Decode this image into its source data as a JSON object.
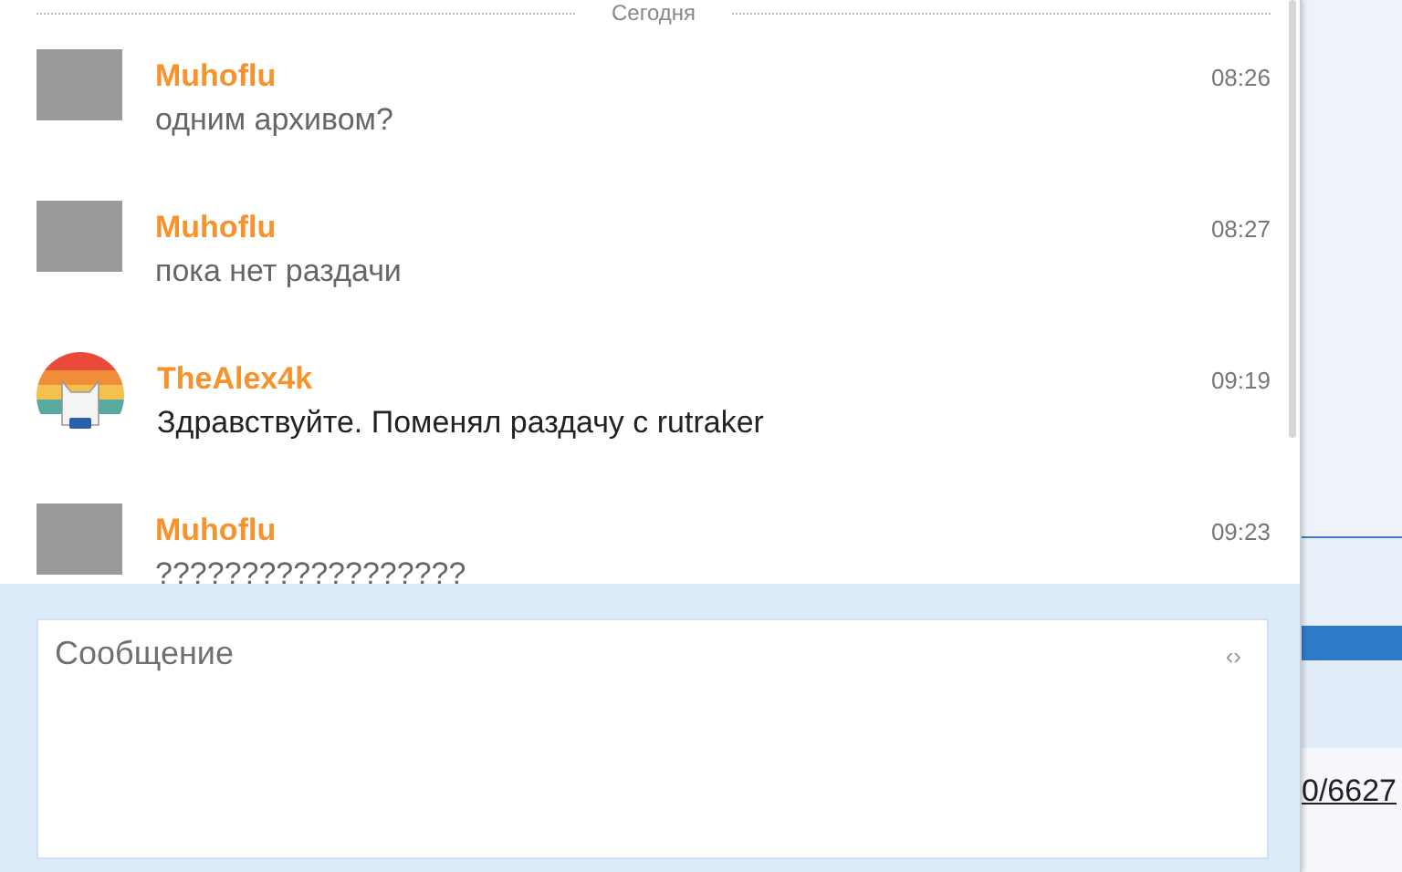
{
  "divider": {
    "label": "Сегодня"
  },
  "messages": [
    {
      "author": "Muhoflu",
      "time": "08:26",
      "text": "одним архивом?",
      "kind": "photo",
      "dimmed": true
    },
    {
      "author": "Muhoflu",
      "time": "08:27",
      "text": "пока нет раздачи",
      "kind": "photo",
      "dimmed": true
    },
    {
      "author": "TheAlex4k",
      "time": "09:19",
      "text": "Здравствуйте. Поменял раздачу с rutraker",
      "kind": "logo",
      "dimmed": false
    },
    {
      "author": "Muhoflu",
      "time": "09:23",
      "text": "??????????????????",
      "kind": "photo",
      "dimmed": true
    }
  ],
  "composer": {
    "placeholder": "Сообщение",
    "toggle": "‹›"
  },
  "background": {
    "link": "0/6627"
  }
}
